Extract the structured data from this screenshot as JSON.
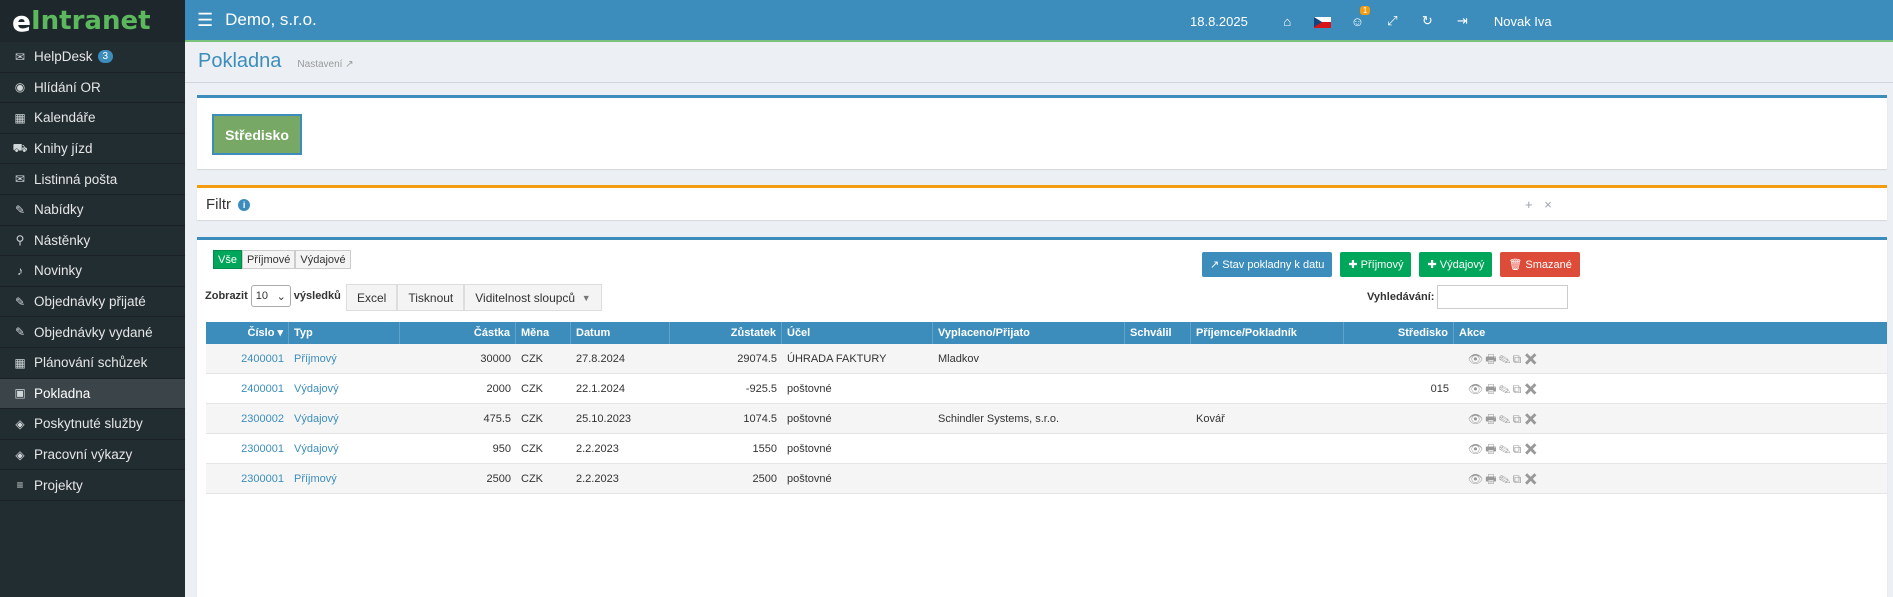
{
  "logo": {
    "e": "e",
    "rest": "Intranet"
  },
  "sidebar": {
    "items": [
      {
        "label": "HelpDesk",
        "badge": "3",
        "icon": "envelope-icon",
        "glyph": "✉"
      },
      {
        "label": "Hlídání OR",
        "icon": "eye-icon",
        "glyph": "◉"
      },
      {
        "label": "Kalendáře",
        "icon": "calendar-icon",
        "glyph": "▦"
      },
      {
        "label": "Knihy jízd",
        "icon": "car-icon",
        "glyph": "⛟"
      },
      {
        "label": "Listinná pošta",
        "icon": "envelope-icon",
        "glyph": "✉"
      },
      {
        "label": "Nabídky",
        "icon": "edit-icon",
        "glyph": "✎"
      },
      {
        "label": "Nástěnky",
        "icon": "pin-icon",
        "glyph": "⚲"
      },
      {
        "label": "Novinky",
        "icon": "bell-icon",
        "glyph": "♪"
      },
      {
        "label": "Objednávky přijaté",
        "icon": "edit-icon",
        "glyph": "✎"
      },
      {
        "label": "Objednávky vydané",
        "icon": "edit-icon",
        "glyph": "✎"
      },
      {
        "label": "Plánování schůzek",
        "icon": "calendar-icon",
        "glyph": "▦"
      },
      {
        "label": "Pokladna",
        "icon": "money-icon",
        "glyph": "▣",
        "active": true
      },
      {
        "label": "Poskytnuté služby",
        "icon": "tag-icon",
        "glyph": "◈"
      },
      {
        "label": "Pracovní výkazy",
        "icon": "tag-icon",
        "glyph": "◈"
      },
      {
        "label": "Projekty",
        "icon": "list-icon",
        "glyph": "≡"
      }
    ]
  },
  "topbar": {
    "menu_icon": "☰",
    "company": "Demo, s.r.o.",
    "date": "18.8.2025",
    "notif_count": "1",
    "user": "Novak Iva",
    "icons": {
      "home": "⌂",
      "fullscreen": "⤢",
      "refresh": "↻",
      "logout": "⇥",
      "users": "☺"
    }
  },
  "page": {
    "title": "Pokladna",
    "settings_link": "Nastavení ↗"
  },
  "stredisko_button": "Středisko",
  "filter": {
    "title": "Filtr",
    "info": "i",
    "plus": "+",
    "close": "×"
  },
  "type_buttons": [
    "Vše",
    "Příjmové",
    "Výdajové"
  ],
  "action_buttons": {
    "stav": "↗ Stav pokladny k datu",
    "prijmovy": "✚ Příjmový",
    "vydajovy": "✚ Výdajový",
    "smazane": "🗑 Smazané"
  },
  "length": {
    "prefix": "Zobrazit",
    "value": "10",
    "suffix": "výsledků",
    "caret": "⌄"
  },
  "export_buttons": {
    "excel": "Excel",
    "print": "Tisknout",
    "columns": "Viditelnost sloupců",
    "caret": "▼"
  },
  "search": {
    "label": "Vyhledávání:",
    "value": ""
  },
  "table": {
    "headers": {
      "cislo": "Číslo",
      "typ": "Typ",
      "castka": "Částka",
      "mena": "Měna",
      "datum": "Datum",
      "zustatek": "Zůstatek",
      "ucel": "Účel",
      "vyplaceno": "Vyplaceno/Přijato",
      "schvalil": "Schválil",
      "prijemce": "Příjemce/Pokladník",
      "stredisko": "Středisko",
      "akce": "Akce"
    },
    "action_glyphs": "👁🖶✎⧉✖",
    "rows": [
      {
        "cislo": "2400001",
        "typ": "Příjmový",
        "castka": "30000",
        "mena": "CZK",
        "datum": "27.8.2024",
        "zustatek": "29074.5",
        "ucel": "ÚHRADA FAKTURY",
        "vyplaceno": "Mladkov",
        "schvalil": "",
        "prijemce": "",
        "stredisko": ""
      },
      {
        "cislo": "2400001",
        "typ": "Výdajový",
        "castka": "2000",
        "mena": "CZK",
        "datum": "22.1.2024",
        "zustatek": "-925.5",
        "ucel": "poštovné",
        "vyplaceno": "",
        "schvalil": "",
        "prijemce": "",
        "stredisko": "015"
      },
      {
        "cislo": "2300002",
        "typ": "Výdajový",
        "castka": "475.5",
        "mena": "CZK",
        "datum": "25.10.2023",
        "zustatek": "1074.5",
        "ucel": "poštovné",
        "vyplaceno": "Schindler Systems, s.r.o.",
        "schvalil": "",
        "prijemce": "Kovář",
        "stredisko": ""
      },
      {
        "cislo": "2300001",
        "typ": "Výdajový",
        "castka": "950",
        "mena": "CZK",
        "datum": "2.2.2023",
        "zustatek": "1550",
        "ucel": "poštovné",
        "vyplaceno": "",
        "schvalil": "",
        "prijemce": "",
        "stredisko": ""
      },
      {
        "cislo": "2300001",
        "typ": "Příjmový",
        "castka": "2500",
        "mena": "CZK",
        "datum": "2.2.2023",
        "zustatek": "2500",
        "ucel": "poštovné",
        "vyplaceno": "",
        "schvalil": "",
        "prijemce": "",
        "stredisko": ""
      }
    ]
  }
}
